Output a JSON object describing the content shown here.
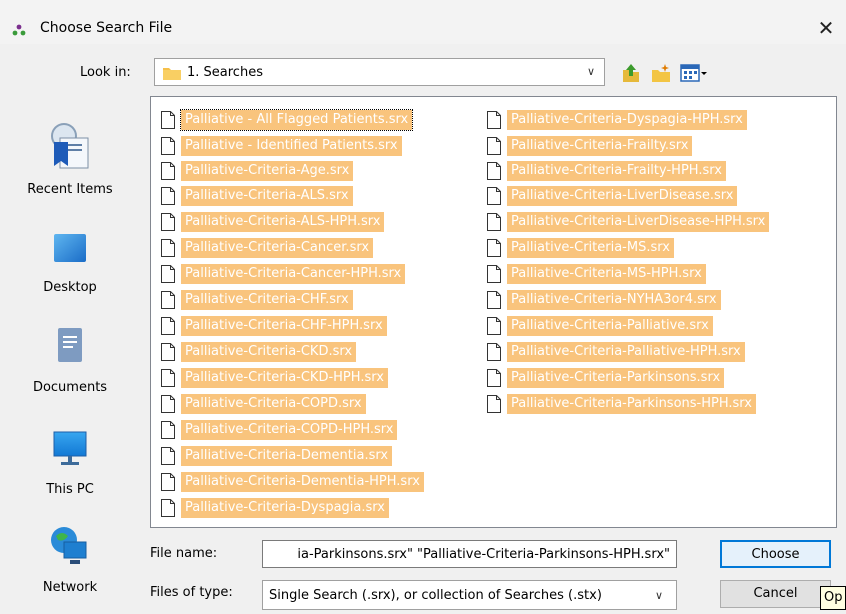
{
  "window": {
    "title": "Choose Search File",
    "close_glyph": "✕"
  },
  "lookin": {
    "label": "Look in:",
    "value": "1. Searches"
  },
  "toolbar": {
    "icons": [
      "up-folder-icon",
      "new-folder-icon",
      "view-menu-icon"
    ]
  },
  "sidebar": {
    "items": [
      {
        "label": "Recent Items",
        "icon": "recent-items-icon"
      },
      {
        "label": "Desktop",
        "icon": "desktop-icon"
      },
      {
        "label": "Documents",
        "icon": "documents-icon"
      },
      {
        "label": "This PC",
        "icon": "this-pc-icon"
      },
      {
        "label": "Network",
        "icon": "network-icon"
      }
    ]
  },
  "files": {
    "column1": [
      "Palliative - All Flagged Patients.srx",
      "Palliative - Identified Patients.srx",
      "Palliative-Criteria-Age.srx",
      "Palliative-Criteria-ALS.srx",
      "Palliative-Criteria-ALS-HPH.srx",
      "Palliative-Criteria-Cancer.srx",
      "Palliative-Criteria-Cancer-HPH.srx",
      "Palliative-Criteria-CHF.srx",
      "Palliative-Criteria-CHF-HPH.srx",
      "Palliative-Criteria-CKD.srx",
      "Palliative-Criteria-CKD-HPH.srx",
      "Palliative-Criteria-COPD.srx",
      "Palliative-Criteria-COPD-HPH.srx",
      "Palliative-Criteria-Dementia.srx",
      "Palliative-Criteria-Dementia-HPH.srx",
      "Palliative-Criteria-Dyspagia.srx"
    ],
    "column2": [
      "Palliative-Criteria-Dyspagia-HPH.srx",
      "Palliative-Criteria-Frailty.srx",
      "Palliative-Criteria-Frailty-HPH.srx",
      "Palliative-Criteria-LiverDisease.srx",
      "Palliative-Criteria-LiverDisease-HPH.srx",
      "Palliative-Criteria-MS.srx",
      "Palliative-Criteria-MS-HPH.srx",
      "Palliative-Criteria-NYHA3or4.srx",
      "Palliative-Criteria-Palliative.srx",
      "Palliative-Criteria-Palliative-HPH.srx",
      "Palliative-Criteria-Parkinsons.srx",
      "Palliative-Criteria-Parkinsons-HPH.srx"
    ],
    "selection_color": "#f9c47d"
  },
  "filename": {
    "label": "File name:",
    "value": "ia-Parkinsons.srx\" \"Palliative-Criteria-Parkinsons-HPH.srx\""
  },
  "filetype": {
    "label": "Files of type:",
    "value": "Single Search (.srx), or collection of Searches (.stx)"
  },
  "buttons": {
    "choose": "Choose",
    "cancel": "Cancel"
  },
  "tooltip": {
    "text": "Op"
  }
}
